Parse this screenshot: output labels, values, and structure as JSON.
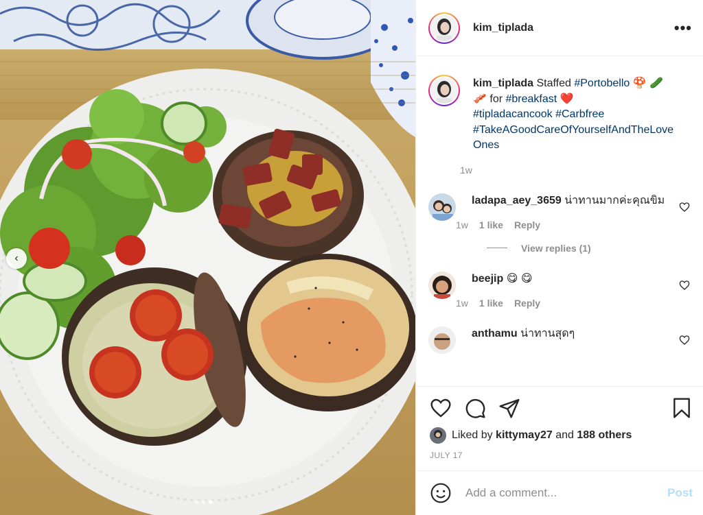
{
  "post": {
    "username": "kim_tiplada",
    "more_label": "•••",
    "carousel": {
      "total": 3,
      "current": 3,
      "prev_icon": "chevron-left-icon"
    }
  },
  "caption": {
    "username": "kim_tiplada",
    "text_pre": "Staffed ",
    "tag_portobello": "#Portobello",
    "emoji_line": " 🍄 🥒 🥓 for ",
    "tag_breakfast": "#breakfast",
    "heart": " ❤️",
    "tag_cook": "#tipladacancook",
    "tag_carbfree": "#Carbfree",
    "tag_care": "#TakeAGoodCareOfYourselfAndTheLoveOnes",
    "time": "1w"
  },
  "comments": [
    {
      "username": "ladapa_aey_3659",
      "text": "น่าทานมากค่ะคุณขิม",
      "time": "1w",
      "likes": "1 like",
      "reply": "Reply",
      "view_replies": "View replies (1)"
    },
    {
      "username": "beejip",
      "text": "😋 😋",
      "time": "1w",
      "likes": "1 like",
      "reply": "Reply"
    },
    {
      "username": "anthamu",
      "text": "น่าทานสุดๆ"
    }
  ],
  "actions": {
    "liked_prefix": "Liked by ",
    "liked_user": "kittymay27",
    "and": " and ",
    "others": "188 others",
    "date": "JULY 17"
  },
  "add_comment": {
    "placeholder": "Add a comment...",
    "post_label": "Post"
  },
  "colors": {
    "link": "#00376b",
    "muted": "#8e8e8e",
    "post_disabled": "#b2dffc"
  }
}
